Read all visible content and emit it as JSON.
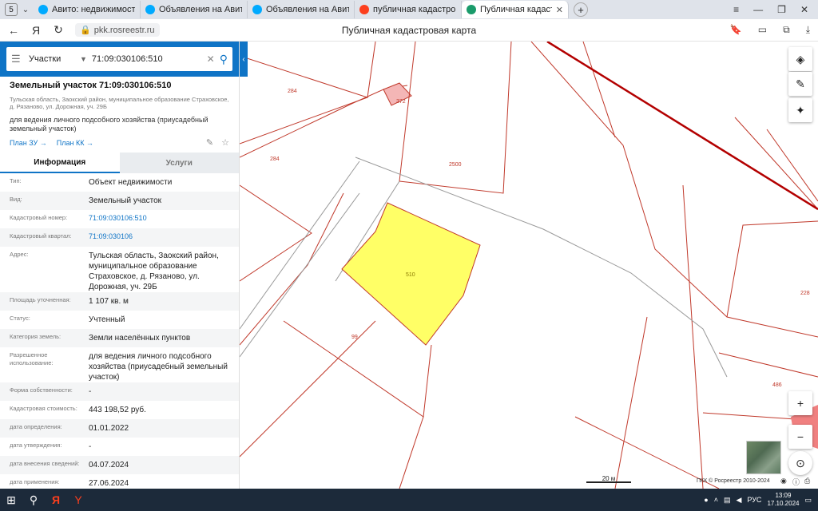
{
  "browser": {
    "tab_count": "5",
    "tabs": [
      {
        "label": "Авито: недвижимость, тр",
        "icon_color": "#00aaff"
      },
      {
        "label": "Объявления на Авито Pr",
        "icon_color": "#00aaff"
      },
      {
        "label": "Объявления на Авито Pr",
        "icon_color": "#00aaff"
      },
      {
        "label": "публичная кадастровая к",
        "icon_color": "#fc3f1d"
      },
      {
        "label": "Публичная кадастрова",
        "icon_color": "#1a9b6b"
      }
    ],
    "url": "pkk.rosreestr.ru",
    "page_title": "Публичная кадастровая карта"
  },
  "search": {
    "category": "Участки",
    "query": "71:09:030106:510"
  },
  "object": {
    "title": "Земельный участок 71:09:030106:510",
    "address_short": "Тульская область, Заокский район, муниципальное образование Страховское, д. Рязаново, ул. Дорожная, уч. 29Б",
    "use": "для ведения личного подсобного хозяйства (приусадебный земельный участок)",
    "link_plan_zu": "План ЗУ →",
    "link_plan_kk": "План КК →"
  },
  "info_tabs": {
    "info": "Информация",
    "services": "Услуги"
  },
  "properties": [
    {
      "label": "Тип:",
      "value": "Объект недвижимости",
      "link": false
    },
    {
      "label": "Вид:",
      "value": "Земельный участок",
      "link": false
    },
    {
      "label": "Кадастровый номер:",
      "value": "71:09:030106:510",
      "link": true
    },
    {
      "label": "Кадастровый квартал:",
      "value": "71:09:030106",
      "link": true
    },
    {
      "label": "Адрес:",
      "value": "Тульская область, Заокский район, муниципальное образование Страховское, д. Рязаново, ул. Дорожная, уч. 29Б",
      "link": false
    },
    {
      "label": "Площадь уточненная:",
      "value": "1 107 кв. м",
      "link": false
    },
    {
      "label": "Статус:",
      "value": "Учтенный",
      "link": false
    },
    {
      "label": "Категория земель:",
      "value": "Земли населённых пунктов",
      "link": false
    },
    {
      "label": "Разрешенное использование:",
      "value": "для ведения личного подсобного хозяйства (приусадебный земельный участок)",
      "link": false
    },
    {
      "label": "Форма собственности:",
      "value": "-",
      "link": false
    },
    {
      "label": "Кадастровая стоимость:",
      "value": "443 198,52 руб.",
      "link": false
    },
    {
      "label": "дата определения:",
      "value": "01.01.2022",
      "link": false
    },
    {
      "label": "дата утверждения:",
      "value": "-",
      "link": false
    },
    {
      "label": "дата внесения сведений:",
      "value": "04.07.2024",
      "link": false
    },
    {
      "label": "дата применения:",
      "value": "27.06.2024",
      "link": false
    }
  ],
  "map": {
    "parcel_labels": {
      "p284a": "284",
      "p372": "372",
      "p284b": "284",
      "p2500": "2500",
      "p510": "510",
      "p99": "99",
      "p228": "228",
      "p486": "486"
    },
    "highlight_color": "#ffff66",
    "boundary_color": "#c0392b",
    "scale": "20 м",
    "copyright": "ПКК © Росреестр 2010-2024",
    "controls": {
      "layers": "layers-icon",
      "ruler": "ruler-icon",
      "compass": "compass-icon",
      "zoom_in": "+",
      "zoom_out": "−"
    }
  },
  "taskbar": {
    "lang": "РУС",
    "time": "13:09",
    "date": "17.10.2024"
  }
}
